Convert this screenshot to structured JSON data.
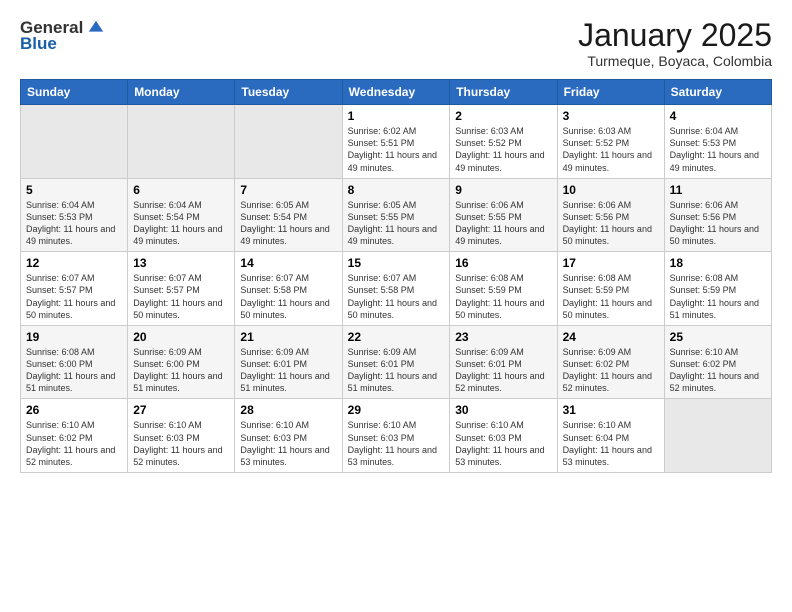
{
  "header": {
    "logo_general": "General",
    "logo_blue": "Blue",
    "month_title": "January 2025",
    "location": "Turmeque, Boyaca, Colombia"
  },
  "days_of_week": [
    "Sunday",
    "Monday",
    "Tuesday",
    "Wednesday",
    "Thursday",
    "Friday",
    "Saturday"
  ],
  "weeks": [
    [
      {
        "num": "",
        "info": ""
      },
      {
        "num": "",
        "info": ""
      },
      {
        "num": "",
        "info": ""
      },
      {
        "num": "1",
        "info": "Sunrise: 6:02 AM\nSunset: 5:51 PM\nDaylight: 11 hours and 49 minutes."
      },
      {
        "num": "2",
        "info": "Sunrise: 6:03 AM\nSunset: 5:52 PM\nDaylight: 11 hours and 49 minutes."
      },
      {
        "num": "3",
        "info": "Sunrise: 6:03 AM\nSunset: 5:52 PM\nDaylight: 11 hours and 49 minutes."
      },
      {
        "num": "4",
        "info": "Sunrise: 6:04 AM\nSunset: 5:53 PM\nDaylight: 11 hours and 49 minutes."
      }
    ],
    [
      {
        "num": "5",
        "info": "Sunrise: 6:04 AM\nSunset: 5:53 PM\nDaylight: 11 hours and 49 minutes."
      },
      {
        "num": "6",
        "info": "Sunrise: 6:04 AM\nSunset: 5:54 PM\nDaylight: 11 hours and 49 minutes."
      },
      {
        "num": "7",
        "info": "Sunrise: 6:05 AM\nSunset: 5:54 PM\nDaylight: 11 hours and 49 minutes."
      },
      {
        "num": "8",
        "info": "Sunrise: 6:05 AM\nSunset: 5:55 PM\nDaylight: 11 hours and 49 minutes."
      },
      {
        "num": "9",
        "info": "Sunrise: 6:06 AM\nSunset: 5:55 PM\nDaylight: 11 hours and 49 minutes."
      },
      {
        "num": "10",
        "info": "Sunrise: 6:06 AM\nSunset: 5:56 PM\nDaylight: 11 hours and 50 minutes."
      },
      {
        "num": "11",
        "info": "Sunrise: 6:06 AM\nSunset: 5:56 PM\nDaylight: 11 hours and 50 minutes."
      }
    ],
    [
      {
        "num": "12",
        "info": "Sunrise: 6:07 AM\nSunset: 5:57 PM\nDaylight: 11 hours and 50 minutes."
      },
      {
        "num": "13",
        "info": "Sunrise: 6:07 AM\nSunset: 5:57 PM\nDaylight: 11 hours and 50 minutes."
      },
      {
        "num": "14",
        "info": "Sunrise: 6:07 AM\nSunset: 5:58 PM\nDaylight: 11 hours and 50 minutes."
      },
      {
        "num": "15",
        "info": "Sunrise: 6:07 AM\nSunset: 5:58 PM\nDaylight: 11 hours and 50 minutes."
      },
      {
        "num": "16",
        "info": "Sunrise: 6:08 AM\nSunset: 5:59 PM\nDaylight: 11 hours and 50 minutes."
      },
      {
        "num": "17",
        "info": "Sunrise: 6:08 AM\nSunset: 5:59 PM\nDaylight: 11 hours and 50 minutes."
      },
      {
        "num": "18",
        "info": "Sunrise: 6:08 AM\nSunset: 5:59 PM\nDaylight: 11 hours and 51 minutes."
      }
    ],
    [
      {
        "num": "19",
        "info": "Sunrise: 6:08 AM\nSunset: 6:00 PM\nDaylight: 11 hours and 51 minutes."
      },
      {
        "num": "20",
        "info": "Sunrise: 6:09 AM\nSunset: 6:00 PM\nDaylight: 11 hours and 51 minutes."
      },
      {
        "num": "21",
        "info": "Sunrise: 6:09 AM\nSunset: 6:01 PM\nDaylight: 11 hours and 51 minutes."
      },
      {
        "num": "22",
        "info": "Sunrise: 6:09 AM\nSunset: 6:01 PM\nDaylight: 11 hours and 51 minutes."
      },
      {
        "num": "23",
        "info": "Sunrise: 6:09 AM\nSunset: 6:01 PM\nDaylight: 11 hours and 52 minutes."
      },
      {
        "num": "24",
        "info": "Sunrise: 6:09 AM\nSunset: 6:02 PM\nDaylight: 11 hours and 52 minutes."
      },
      {
        "num": "25",
        "info": "Sunrise: 6:10 AM\nSunset: 6:02 PM\nDaylight: 11 hours and 52 minutes."
      }
    ],
    [
      {
        "num": "26",
        "info": "Sunrise: 6:10 AM\nSunset: 6:02 PM\nDaylight: 11 hours and 52 minutes."
      },
      {
        "num": "27",
        "info": "Sunrise: 6:10 AM\nSunset: 6:03 PM\nDaylight: 11 hours and 52 minutes."
      },
      {
        "num": "28",
        "info": "Sunrise: 6:10 AM\nSunset: 6:03 PM\nDaylight: 11 hours and 53 minutes."
      },
      {
        "num": "29",
        "info": "Sunrise: 6:10 AM\nSunset: 6:03 PM\nDaylight: 11 hours and 53 minutes."
      },
      {
        "num": "30",
        "info": "Sunrise: 6:10 AM\nSunset: 6:03 PM\nDaylight: 11 hours and 53 minutes."
      },
      {
        "num": "31",
        "info": "Sunrise: 6:10 AM\nSunset: 6:04 PM\nDaylight: 11 hours and 53 minutes."
      },
      {
        "num": "",
        "info": ""
      }
    ]
  ]
}
